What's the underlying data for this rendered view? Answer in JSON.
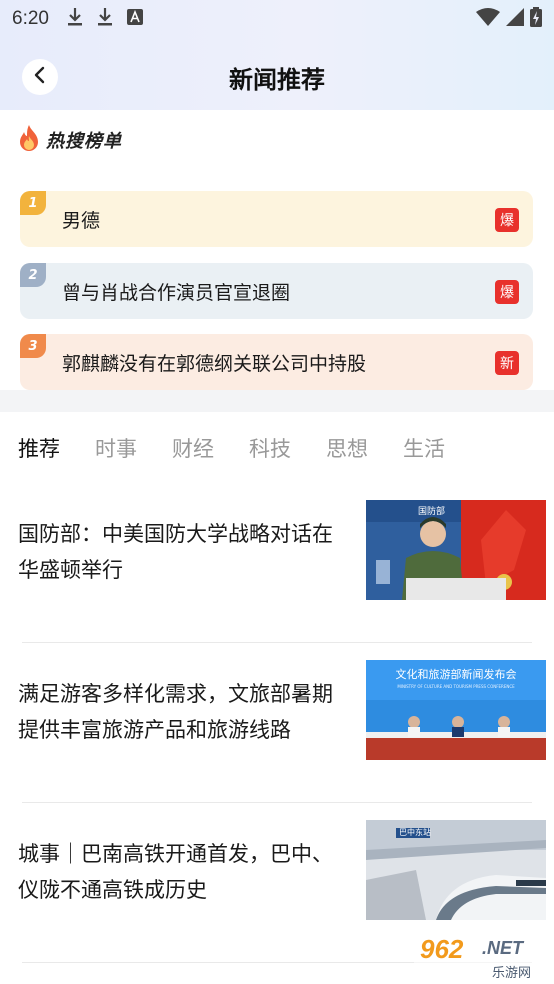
{
  "status_bar": {
    "time": "6:20"
  },
  "header": {
    "title": "新闻推荐"
  },
  "hot_list": {
    "title": "热搜榜单",
    "items": [
      {
        "rank": "1",
        "text": "男德",
        "tag": "爆"
      },
      {
        "rank": "2",
        "text": "曾与肖战合作演员官宣退圈",
        "tag": "爆"
      },
      {
        "rank": "3",
        "text": "郭麒麟没有在郭德纲关联公司中持股",
        "tag": "新"
      }
    ]
  },
  "tabs": [
    "推荐",
    "时事",
    "财经",
    "科技",
    "思想",
    "生活"
  ],
  "articles": [
    {
      "title": "国防部：中美国防大学战略对话在华盛顿举行",
      "image_caption": "国防部"
    },
    {
      "title": "满足游客多样化需求，文旅部暑期提供丰富旅游产品和旅游线路",
      "image_caption": "文化和旅游部新闻发布会",
      "image_subcaption": "MINISTRY OF CULTURE AND TOURISM PRESS CONFERENCE"
    },
    {
      "title": "城事｜巴南高铁开通首发，巴中、仪陇不通高铁成历史",
      "image_caption": "巴中东站"
    }
  ],
  "watermark": {
    "number": "962",
    "suffix": ".NET",
    "brand": "乐游网"
  },
  "colors": {
    "accent_red": "#e8312c",
    "rank1": "#f2b33d",
    "rank2": "#9fb0c6",
    "rank3": "#f08a4b"
  }
}
